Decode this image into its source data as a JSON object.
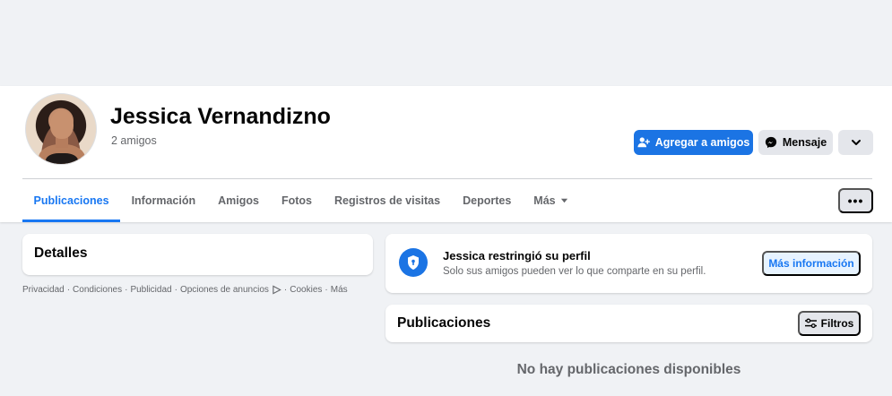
{
  "profile": {
    "name": "Jessica Vernandizno",
    "friends_count": "2 amigos"
  },
  "actions": {
    "add_friend_label": "Agregar a amigos",
    "message_label": "Mensaje"
  },
  "tabs": [
    {
      "label": "Publicaciones",
      "active": true
    },
    {
      "label": "Información"
    },
    {
      "label": "Amigos"
    },
    {
      "label": "Fotos"
    },
    {
      "label": "Registros de visitas"
    },
    {
      "label": "Deportes"
    },
    {
      "label": "Más"
    }
  ],
  "more_dots": "•••",
  "details": {
    "title": "Detalles"
  },
  "footer": {
    "privacy": "Privacidad",
    "terms": "Condiciones",
    "ads": "Publicidad",
    "ad_choices": "Opciones de anuncios",
    "cookies": "Cookies",
    "more": "Más",
    "separator": "·"
  },
  "restriction": {
    "title": "Jessica restringió su perfil",
    "description": "Solo sus amigos pueden ver lo que comparte en su perfil.",
    "more_info_label": "Más información"
  },
  "posts": {
    "title": "Publicaciones",
    "filters_label": "Filtros",
    "empty_message": "No hay publicaciones disponibles"
  },
  "colors": {
    "primary": "#1b74e4",
    "background": "#f0f2f5",
    "secondary_button": "#e4e6eb",
    "muted_text": "#65676b"
  }
}
